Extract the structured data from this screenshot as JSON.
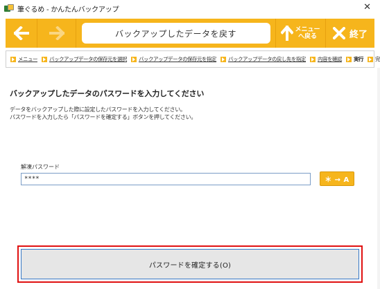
{
  "window": {
    "title": "筆ぐるめ - かんたんバックアップ",
    "close_symbol": "✕"
  },
  "toolbar": {
    "back_icon": "arrow-left-icon",
    "forward_icon": "arrow-right-icon",
    "title": "バックアップしたデータを戻す",
    "menu_label_line1": "メニュー",
    "menu_label_line2": "へ戻る",
    "exit_label": "終了",
    "accent_color": "#f6b51c"
  },
  "breadcrumb": {
    "steps": [
      {
        "label": "メニュー",
        "type": "link"
      },
      {
        "label": "バックアップデータの保存元を選択",
        "type": "link"
      },
      {
        "label": "バックアップデータの保存元を指定",
        "type": "link"
      },
      {
        "label": "バックアップデータの戻し先を指定",
        "type": "link"
      },
      {
        "label": "内容を確認",
        "type": "link"
      },
      {
        "label": "実行",
        "type": "current"
      },
      {
        "label": "完了",
        "type": "plain"
      }
    ]
  },
  "main": {
    "heading": "バックアップしたデータのパスワードを入力してください",
    "desc_line1": "データをバックアップした際に設定したパスワードを入力してください。",
    "desc_line2": "パスワードを入力したら「パスワードを確定する」ボタンを押してください。",
    "password_label": "解凍パスワード",
    "password_value": "****",
    "toggle_label": "＊ → A",
    "confirm_label": "パスワードを確定する(O)",
    "highlight_color": "#e01010"
  }
}
